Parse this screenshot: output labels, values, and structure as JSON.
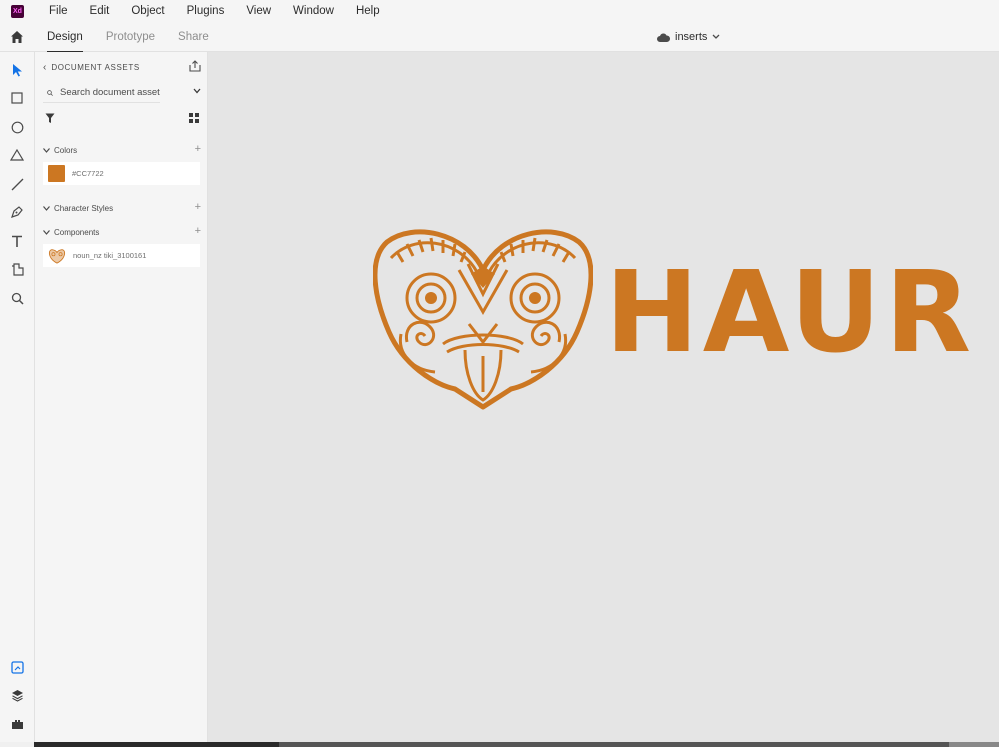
{
  "app": {
    "logo_text": "Xd",
    "brand_color": "#470137",
    "logo_text_color": "#ff61f6"
  },
  "menu": [
    "File",
    "Edit",
    "Object",
    "Plugins",
    "View",
    "Window",
    "Help"
  ],
  "tabs": {
    "home_icon": "home-icon",
    "items": [
      {
        "label": "Design",
        "active": true
      },
      {
        "label": "Prototype",
        "active": false
      },
      {
        "label": "Share",
        "active": false
      }
    ]
  },
  "document": {
    "title": "inserts",
    "cloud_icon": "cloud-icon"
  },
  "tools": [
    {
      "name": "select-tool",
      "icon": "arrow-icon",
      "active": true
    },
    {
      "name": "rectangle-tool",
      "icon": "square-icon"
    },
    {
      "name": "ellipse-tool",
      "icon": "circle-icon"
    },
    {
      "name": "polygon-tool",
      "icon": "triangle-icon"
    },
    {
      "name": "line-tool",
      "icon": "line-icon"
    },
    {
      "name": "pen-tool",
      "icon": "pen-icon"
    },
    {
      "name": "text-tool",
      "icon": "text-icon"
    },
    {
      "name": "artboard-tool",
      "icon": "artboard-icon"
    },
    {
      "name": "zoom-tool",
      "icon": "magnifier-icon"
    }
  ],
  "bottom_tools": [
    {
      "name": "assets-panel-button",
      "icon": "assets-icon",
      "active": true
    },
    {
      "name": "layers-panel-button",
      "icon": "layers-icon"
    },
    {
      "name": "plugins-panel-button",
      "icon": "plugin-icon"
    }
  ],
  "assets_panel": {
    "title": "DOCUMENT ASSETS",
    "search_placeholder": "Search document assets",
    "sections": {
      "colors": {
        "label": "Colors",
        "items": [
          {
            "hex": "#CC7722",
            "label": "#CC7722"
          }
        ]
      },
      "character_styles": {
        "label": "Character Styles",
        "items": []
      },
      "components": {
        "label": "Components",
        "items": [
          {
            "label": "noun_nz tiki_3100161"
          }
        ]
      }
    }
  },
  "canvas": {
    "background": "#e5e5e5",
    "artwork_color": "#CC7722",
    "wordmark": "HAUR"
  }
}
